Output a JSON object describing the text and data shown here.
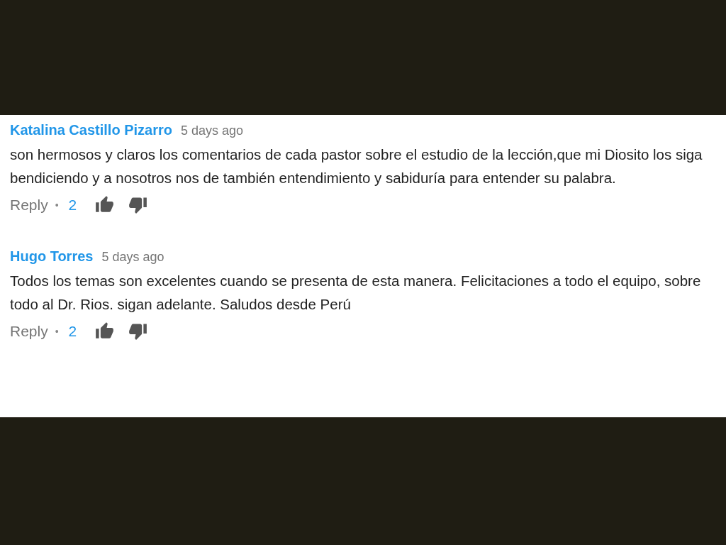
{
  "comments": [
    {
      "author": "Katalina Castillo Pizarro",
      "time": "5 days ago",
      "text": "son hermosos y claros los comentarios de cada pastor sobre el estudio de la lección,que mi Diosito los siga bendiciendo y a nosotros nos de también entendimiento y sabiduría para entender su palabra.",
      "reply": "Reply",
      "separator": "•",
      "likes": "2"
    },
    {
      "author": "Hugo Torres",
      "time": "5 days ago",
      "text": "Todos los temas son excelentes cuando se presenta de esta manera. Felicitaciones a todo el equipo, sobre todo al Dr. Rios. sigan adelante. Saludos desde Perú",
      "reply": "Reply",
      "separator": "•",
      "likes": "2"
    }
  ]
}
